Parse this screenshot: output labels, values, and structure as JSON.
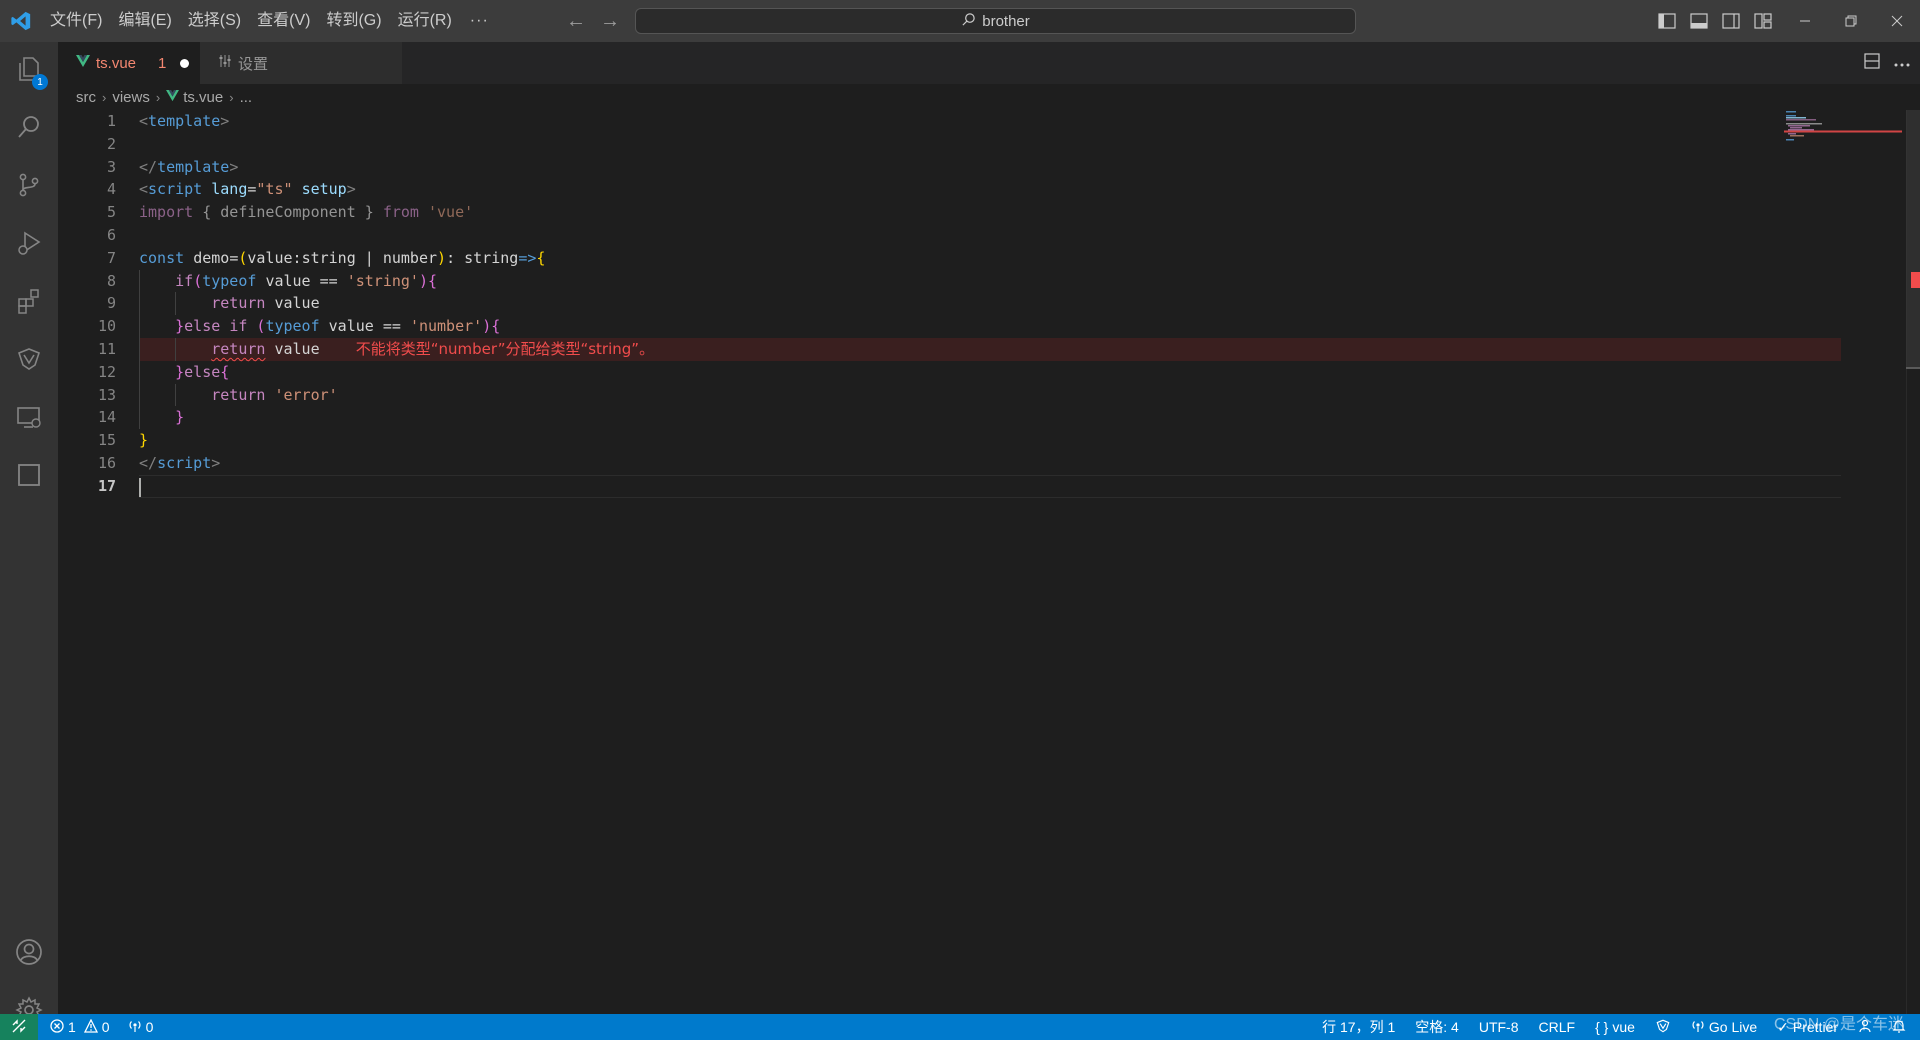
{
  "titlebar": {
    "menu": [
      "文件(F)",
      "编辑(E)",
      "选择(S)",
      "查看(V)",
      "转到(G)",
      "运行(R)"
    ],
    "more": "···",
    "back_arrow": "←",
    "forward_arrow": "→",
    "search_text": "brother"
  },
  "activity": {
    "explorer_badge": "1"
  },
  "tabs": [
    {
      "name": "ts.vue",
      "error_count": "1",
      "dirty": true
    },
    {
      "name": "设置"
    }
  ],
  "breadcrumb": [
    "src",
    "views",
    "ts.vue",
    "..."
  ],
  "editor": {
    "line_numbers": [
      "1",
      "2",
      "3",
      "4",
      "5",
      "6",
      "7",
      "8",
      "9",
      "10",
      "11",
      "12",
      "13",
      "14",
      "15",
      "16",
      "17"
    ],
    "current_line": "17",
    "error_line": "11",
    "error_message": "不能将类型“number”分配给类型“string”。",
    "tokens": {
      "l1": [
        "<",
        "template",
        ">"
      ],
      "l3": [
        "</",
        "template",
        ">"
      ],
      "l4": [
        "<",
        "script",
        " ",
        "lang",
        "=",
        "\"ts\"",
        " ",
        "setup",
        ">"
      ],
      "l5": [
        "import",
        " { ",
        "defineComponent",
        " } ",
        "from",
        " ",
        "'vue'"
      ],
      "l7": [
        "const",
        " ",
        "demo",
        "=",
        "(",
        "value",
        ":",
        "string",
        " | ",
        "number",
        ")",
        ": ",
        "string",
        "=>",
        "{"
      ],
      "l8": [
        "if",
        "(",
        "typeof",
        " ",
        "value",
        " == ",
        "'string'",
        ")",
        "{"
      ],
      "l9": [
        "return",
        " ",
        "value"
      ],
      "l10": [
        "}",
        "else",
        " ",
        "if",
        " ",
        "(",
        "typeof",
        " ",
        "value",
        " == ",
        "'number'",
        ")",
        "{"
      ],
      "l11": [
        "return",
        " ",
        "value"
      ],
      "l12": [
        "}",
        "else",
        "{"
      ],
      "l13": [
        "return",
        " ",
        "'error'"
      ],
      "l14": [
        "}"
      ],
      "l15": [
        "}"
      ],
      "l16": [
        "</",
        "script",
        ">"
      ]
    }
  },
  "statusbar": {
    "errors": "1",
    "warnings": "0",
    "ports": "0",
    "position": "行 17，列 1",
    "spaces": "空格: 4",
    "encoding": "UTF-8",
    "eol": "CRLF",
    "language": "vue",
    "golive": "Go Live",
    "prettier": "Prettier"
  },
  "watermark": "CSDN @是个车迷",
  "colors": {
    "statusbar": "#007acc",
    "remote": "#16825d",
    "error": "#f14c4c",
    "titlebar": "#3c3c3c",
    "editor_bg": "#1e1e1e"
  },
  "icons": [
    "vscode-logo-icon",
    "files-icon",
    "search-icon",
    "source-control-icon",
    "run-debug-icon",
    "extensions-icon",
    "vue-devtools-icon",
    "remote-explorer-icon",
    "square-icon",
    "account-icon",
    "settings-gear-icon"
  ]
}
